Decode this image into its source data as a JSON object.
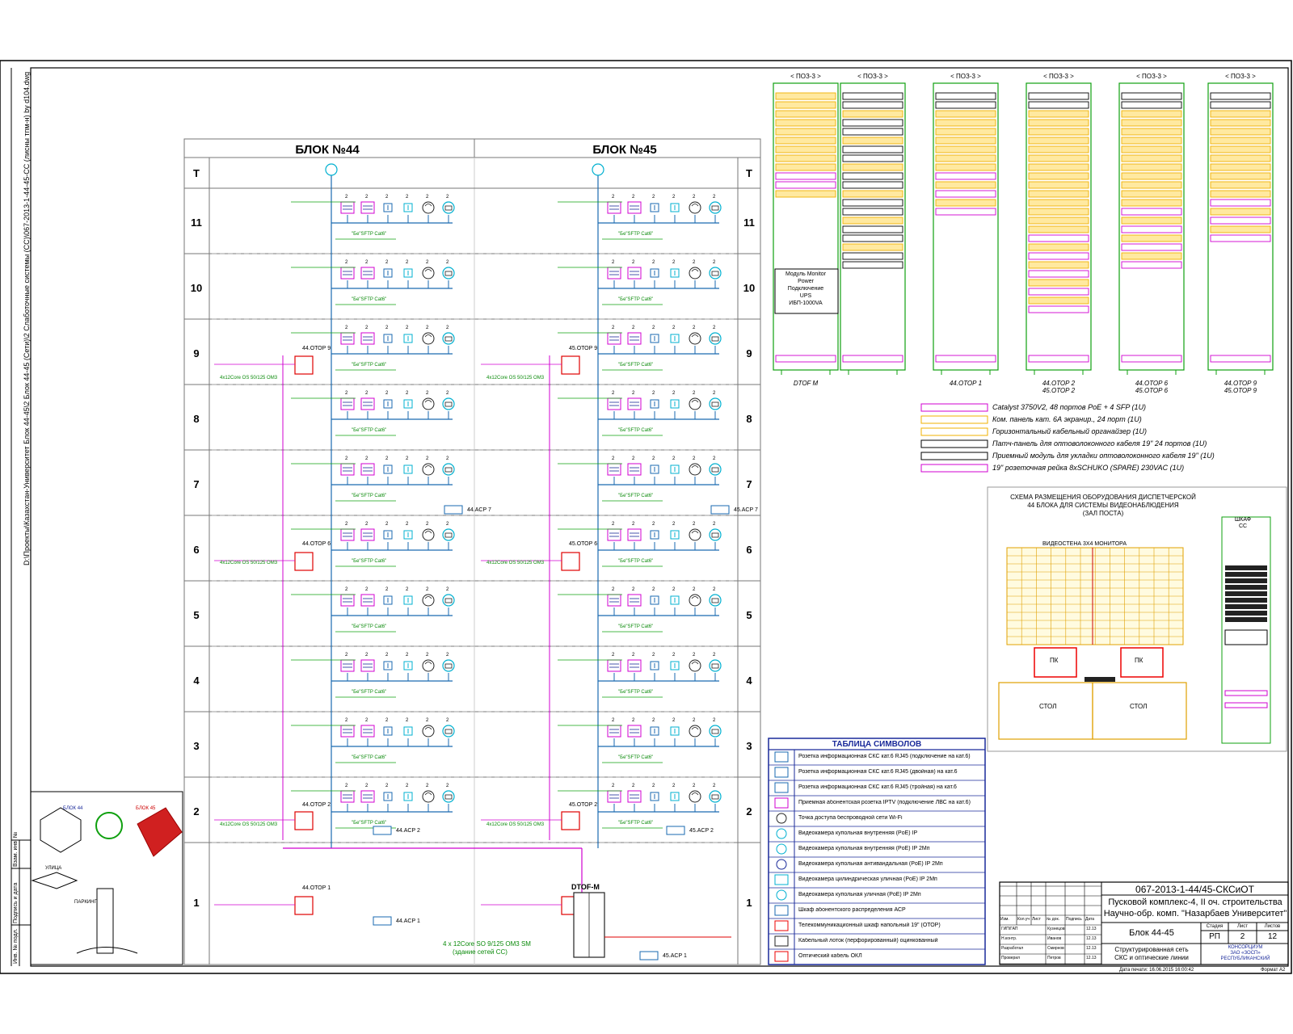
{
  "drawing": {
    "path_text": "D:\\Проекты\\Казахстан-Университет Блок 44-45\\2 Блок 44-45 (Сети)\\2 Слаботочные системы (СС)\\067-2013-1-44-45-СС (лисны тпм-н) by d104.dwg",
    "blocks": [
      "БЛОК №44",
      "БЛОК №45"
    ],
    "floor_header": "T",
    "floors": [
      "11",
      "10",
      "9",
      "8",
      "7",
      "6",
      "5",
      "4",
      "3",
      "2",
      "1"
    ],
    "cable_label": "\"Бе\"SFTP Cat6\"",
    "fiber_label": "4x12Core OS 50/125 OM3",
    "block44_cabinets": [
      "44.ОТОР 9",
      "44.ОТОР 6",
      "44.ОТОР 2",
      "44.ОТОР 1"
    ],
    "block45_cabinets": [
      "45.ОТОР 9",
      "45.ОТОР 6",
      "45.ОТОР 2"
    ],
    "acp_labels": [
      "44.ACP 7",
      "45.ACP 7",
      "44.ACP 2",
      "45.ACP 2",
      "44.ACP 1",
      "45.ACP 1"
    ],
    "main_cabinet": "DTOF-M",
    "backbone_note_1": "4 x 12Core SO 9/125 OM3 SM",
    "backbone_note_2": "(здание сетей СС)",
    "outlet_icon_texts": [
      "ICTV",
      "TV",
      "T"
    ]
  },
  "racks": {
    "top_label": "< ПОЗ-3 >",
    "bottom_labels": [
      "DTOF M",
      "44.ОТОР 1",
      "44.ОТОР 2\n45.ОТОР 2",
      "44.ОТОР 6\n45.ОТОР 6",
      "44.ОТОР 9\n45.ОТОР 9"
    ],
    "ups_box_lines": [
      "Модуль Monitor",
      "Power",
      "Подключение",
      "UPS",
      "ИБП-1000VA"
    ]
  },
  "rack_legend": [
    {
      "text": "Catalyst 3750V2, 48 портов PoE + 4 SFP (1U)",
      "color": "#d000d0"
    },
    {
      "text": "Ком. панель кат. 6А экранир., 24 порт (1U)",
      "color": "#f0b000"
    },
    {
      "text": "Горизонтальный кабельный органайзер (1U)",
      "color": "#f0b000"
    },
    {
      "text": "Патч-панель для оптоволоконного кабеля 19\" 24 портов (1U)",
      "color": "#000000"
    },
    {
      "text": "Приемный модуль для укладки оптоволоконного кабеля 19\" (1U)",
      "color": "#000000"
    },
    {
      "text": "19\" розеточная рейка 8xSCHUKO (SPARE) 230VAC (1U)",
      "color": "#d000d0"
    }
  ],
  "control_room": {
    "title_lines": [
      "СХЕМА РАЗМЕЩЕНИЯ ОБОРУДОВАНИЯ ДИСПЕТЧЕРСКОЙ",
      "44 БЛОКА ДЛЯ СИСТЕМЫ ВИДЕОНАБЛЮДЕНИЯ",
      "(ЗАЛ ПОСТА)"
    ],
    "wall_label": "ВИДЕОСТЕНА 3Х4 МОНИТОРА",
    "pc_label": "ПК",
    "desk_label": "СТОЛ",
    "cabinet_label_lines": [
      "ШКАФ",
      "СС"
    ]
  },
  "symbols_table": {
    "title": "ТАБЛИЦА СИМВОЛОВ",
    "rows": [
      "Розетка информационная СКС кат.6 RJ45 (подключение на кат.6)",
      "Розетка информационная СКС кат.6 RJ45 (двойная) на кат.6",
      "Розетка информационная СКС кат.6 RJ45 (тройная) на кат.6",
      "Приемная абонентская розетка IPTV (подключение ЛВС на кат.6)",
      "Точка доступа беспроводной сети Wi-Fi",
      "Видеокамера купольная внутренняя (PoE) IP",
      "Видеокамера купольная внутренняя (PoE) IP 2Мп",
      "Видеокамера купольная антивандальная (PoE) IP 2Мп",
      "Видеокамера цилиндрическая уличная (PoE) IP 2Мп",
      "Видеокамера купольная уличная (PoE) IP 2Мп",
      "Шкаф абонентского распределения АСР",
      "Телекоммуникационный шкаф напольный 19\" (ОТОР)",
      "Кабельный лоток (перфорированный) оцинкованный",
      "Оптический кабель ОКЛ"
    ]
  },
  "title_block": {
    "code": "067-2013-1-44/45-СКСиОТ",
    "project_line1": "Пусковой комплекс-4, II оч. строительства",
    "project_line2": "Научно-обр. комп. \"Назарбаев Университет\"",
    "block_name": "Блок 44-45",
    "stage_header": "Стадия",
    "sheet_header": "Лист",
    "sheets_header": "Листов",
    "stage": "РП",
    "sheet": "2",
    "sheets": "12",
    "drawing_name_line1": "Структурированная сеть",
    "drawing_name_line2": "СКС и оптические линии",
    "company_line1": "КОНСОРЦИУМ",
    "company_line2": "ЗАО «ЗОСП»",
    "company_line3": "РЕСПУБЛИКАНСКИЙ",
    "cols": [
      "Изм.",
      "Кол.уч",
      "Лист",
      "№ док.",
      "Подпись",
      "Дата"
    ],
    "roles": [
      "ГИП/ГАП",
      "Н.контр.",
      "Разработал",
      "Проверил"
    ],
    "names": [
      "Кузнецов",
      "Иванов",
      "Смирнов",
      "Петров"
    ],
    "dates": [
      "12.13",
      "12.13",
      "12.13",
      "12.13"
    ],
    "footer_date": "Дата печати: 16.06.2015 16:00:42",
    "format": "Формат А2"
  },
  "left_margin": {
    "stamp_texts": [
      "Инв. № подл.",
      "Подпись и дата",
      "Взам. инв. №"
    ]
  },
  "site_plan": {
    "labels": [
      "БЛОК 44",
      "БЛОК 45",
      "УЛИЦА",
      "ПАРКИНГ"
    ]
  }
}
